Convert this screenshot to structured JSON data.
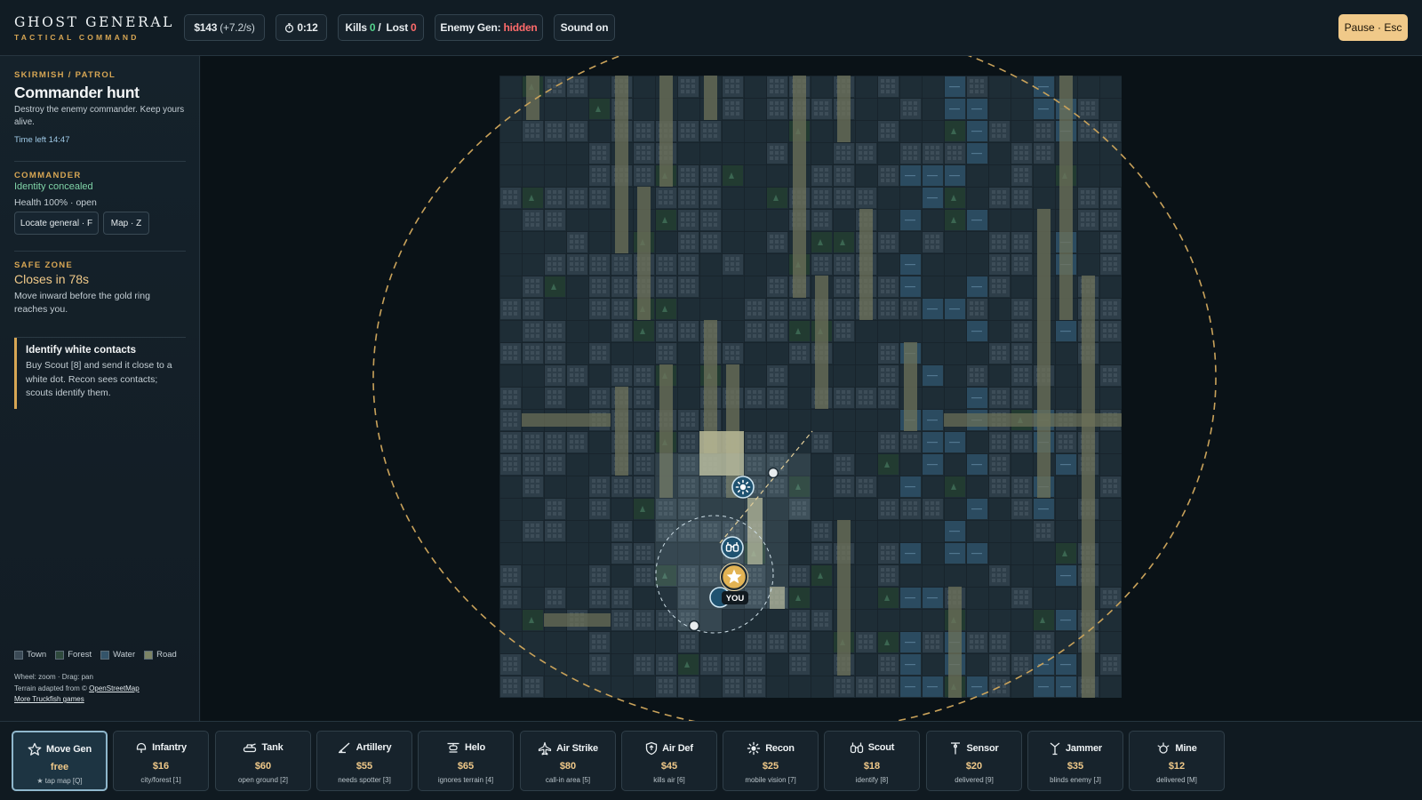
{
  "brand": {
    "title": "GHOST GENERAL",
    "subtitle": "TACTICAL COMMAND"
  },
  "topbar": {
    "money": "$143",
    "money_rate": "(+7.2/s)",
    "timer": "0:12",
    "kills_label": "Kills",
    "kills": "0",
    "lost_label": "Lost",
    "lost": "0",
    "enemy_gen_label": "Enemy Gen:",
    "enemy_gen_value": "hidden",
    "sound": "Sound on",
    "pause": "Pause · Esc"
  },
  "mission": {
    "kicker": "SKIRMISH / PATROL",
    "title": "Commander hunt",
    "description": "Destroy the enemy commander. Keep yours alive.",
    "time_left": "Time left 14:47"
  },
  "commander": {
    "kicker": "COMMANDER",
    "identity": "Identity concealed",
    "health": "Health 100% · open",
    "locate_button": "Locate general · F",
    "map_button": "Map · Z"
  },
  "safe_zone": {
    "kicker": "SAFE ZONE",
    "closes": "Closes in 78s",
    "text": "Move inward before the gold ring reaches you."
  },
  "tip": {
    "title": "Identify white contacts",
    "text": "Buy Scout [8] and send it close to a white dot. Recon sees contacts; scouts identify them."
  },
  "legend": [
    {
      "label": "Town",
      "color": "#3b4a56"
    },
    {
      "label": "Forest",
      "color": "#2f4a3d"
    },
    {
      "label": "Water",
      "color": "#34546a"
    },
    {
      "label": "Road",
      "color": "#7c8466"
    }
  ],
  "credits": {
    "controls": "Wheel: zoom · Drag: pan",
    "terrain_prefix": "Terrain adapted from ©",
    "terrain_link": "OpenStreetMap",
    "more_link": "More Truckfish games"
  },
  "map": {
    "you_label": "YOU",
    "colors": {
      "base": "#1e2d36",
      "town": "#2e3e49",
      "forest": "#223b31",
      "water": "#2b4b60",
      "road": "#6e7259",
      "zone": "#c9a25a"
    }
  },
  "units": [
    {
      "name": "Move Gen",
      "icon": "star-icon",
      "price": "free",
      "sub": "★ tap map [Q]"
    },
    {
      "name": "Infantry",
      "icon": "helmet-icon",
      "price": "$16",
      "sub": "city/forest [1]"
    },
    {
      "name": "Tank",
      "icon": "tank-icon",
      "price": "$60",
      "sub": "open ground [2]"
    },
    {
      "name": "Artillery",
      "icon": "artillery-icon",
      "price": "$55",
      "sub": "needs spotter [3]"
    },
    {
      "name": "Helo",
      "icon": "helicopter-icon",
      "price": "$65",
      "sub": "ignores terrain [4]"
    },
    {
      "name": "Air Strike",
      "icon": "jet-icon",
      "price": "$80",
      "sub": "call-in area [5]"
    },
    {
      "name": "Air Def",
      "icon": "shield-icon",
      "price": "$45",
      "sub": "kills air [6]"
    },
    {
      "name": "Recon",
      "icon": "sun-icon",
      "price": "$25",
      "sub": "mobile vision [7]"
    },
    {
      "name": "Scout",
      "icon": "binoculars-icon",
      "price": "$18",
      "sub": "identify [8]"
    },
    {
      "name": "Sensor",
      "icon": "antenna-icon",
      "price": "$20",
      "sub": "delivered [9]"
    },
    {
      "name": "Jammer",
      "icon": "jammer-icon",
      "price": "$35",
      "sub": "blinds enemy [J]"
    },
    {
      "name": "Mine",
      "icon": "mine-icon",
      "price": "$12",
      "sub": "delivered [M]"
    }
  ]
}
